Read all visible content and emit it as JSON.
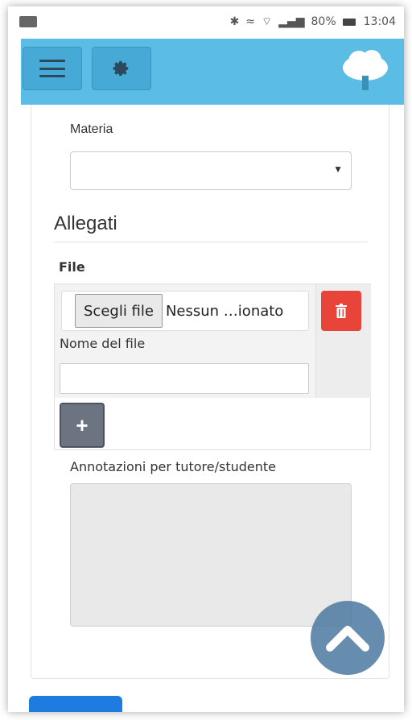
{
  "status_bar": {
    "battery": "80%",
    "time": "13:04"
  },
  "header": {
    "menu_icon": "hamburger-icon",
    "settings_icon": "gear-icon",
    "logo_icon": "cloud-tree-icon",
    "brand_color": "#5bbde5"
  },
  "form": {
    "subject_label": "Materia",
    "subject_value": "",
    "attachments_title": "Allegati",
    "file_label": "File",
    "choose_file_label": "Scegli file",
    "no_file_text": "Nessun …ionato",
    "file_name_label": "Nome del file",
    "file_name_value": "",
    "add_label": "+",
    "notes_label": "Annotazioni per tutore/studente",
    "notes_value": ""
  },
  "colors": {
    "delete": "#e8443a",
    "primary": "#1e7be0"
  }
}
